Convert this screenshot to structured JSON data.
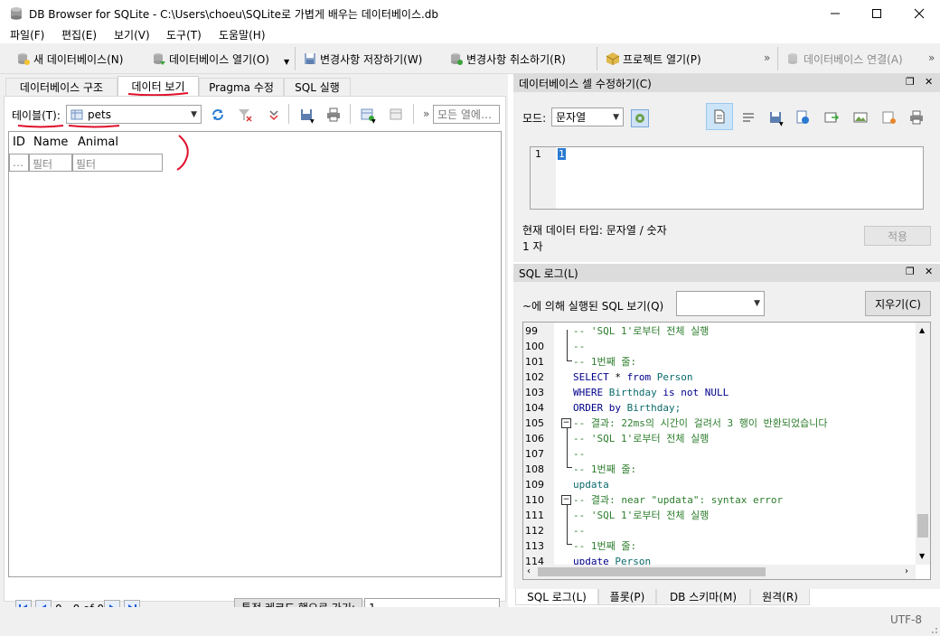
{
  "window": {
    "title": "DB Browser for SQLite - C:\\Users\\choeu\\SQLite로 가볍게 배우는 데이터베이스.db"
  },
  "menu": [
    "파일(F)",
    "편집(E)",
    "보기(V)",
    "도구(T)",
    "도움말(H)"
  ],
  "toolbar": {
    "new_db": "새 데이터베이스(N)",
    "open_db": "데이터베이스 열기(O)",
    "write_changes": "변경사항 저장하기(W)",
    "revert_changes": "변경사항 취소하기(R)",
    "open_project": "프로젝트 열기(P)",
    "attach_db": "데이터베이스 연결(A)",
    "more": "»"
  },
  "left_tabs": [
    "데이터베이스 구조",
    "데이터 보기",
    "Pragma 수정",
    "SQL 실행"
  ],
  "browse": {
    "table_label": "테이블(T):",
    "table_value": "pets",
    "filter_all_placeholder": "모든 열에…",
    "more": "»",
    "columns": [
      "ID",
      "Name",
      "Animal"
    ],
    "filter_cell_dots": "…",
    "filter_placeholder": "필터",
    "record_count": "0 - 0 of 0",
    "goto_label": "특정 레코드 행으로 가기:",
    "goto_value": "1"
  },
  "cell_editor": {
    "title": "데이터베이스 셀 수정하기(C)",
    "mode_label": "모드:",
    "mode_value": "문자열",
    "line_number": "1",
    "cursor_char": "1",
    "data_type": "현재 데이터 타입: 문자열 / 숫자",
    "size": "1 자",
    "apply_label": "적용"
  },
  "sql_log": {
    "title": "SQL 로그(L)",
    "shown_by_label": "~에 의해 실행된 SQL 보기(Q)",
    "clear_label": "지우기(C)",
    "lines": [
      {
        "n": "99",
        "t": "-- 'SQL 1'로부터 전체 실행",
        "c": "green"
      },
      {
        "n": "100",
        "t": "--",
        "c": "green"
      },
      {
        "n": "101",
        "t": "-- 1번째 줄:",
        "c": "green"
      },
      {
        "n": "102",
        "t": "SELECT * from Person",
        "c": "sql"
      },
      {
        "n": "103",
        "t": "WHERE Birthday is not NULL",
        "c": "sql"
      },
      {
        "n": "104",
        "t": "ORDER by Birthday;",
        "c": "sql"
      },
      {
        "n": "105",
        "t": "-- 결과: 22ms의 시간이 걸려서 3 행이 반환되었습니다",
        "c": "green"
      },
      {
        "n": "106",
        "t": "-- 'SQL 1'로부터 전체 실행",
        "c": "green"
      },
      {
        "n": "107",
        "t": "--",
        "c": "green"
      },
      {
        "n": "108",
        "t": "-- 1번째 줄:",
        "c": "green"
      },
      {
        "n": "109",
        "t": "updata",
        "c": "id"
      },
      {
        "n": "110",
        "t": "-- 결과: near \"updata\": syntax error",
        "c": "green"
      },
      {
        "n": "111",
        "t": "-- 'SQL 1'로부터 전체 실행",
        "c": "green"
      },
      {
        "n": "112",
        "t": "--",
        "c": "green"
      },
      {
        "n": "113",
        "t": "-- 1번째 줄:",
        "c": "green"
      },
      {
        "n": "114",
        "t": "update Person",
        "c": "sql"
      }
    ]
  },
  "bottom_tabs": [
    "SQL 로그(L)",
    "플롯(P)",
    "DB 스키마(M)",
    "원격(R)"
  ],
  "status": {
    "encoding": "UTF-8"
  },
  "colors": {
    "annotation_red": "#e0102b",
    "accent_blue": "#1f5bd8"
  }
}
